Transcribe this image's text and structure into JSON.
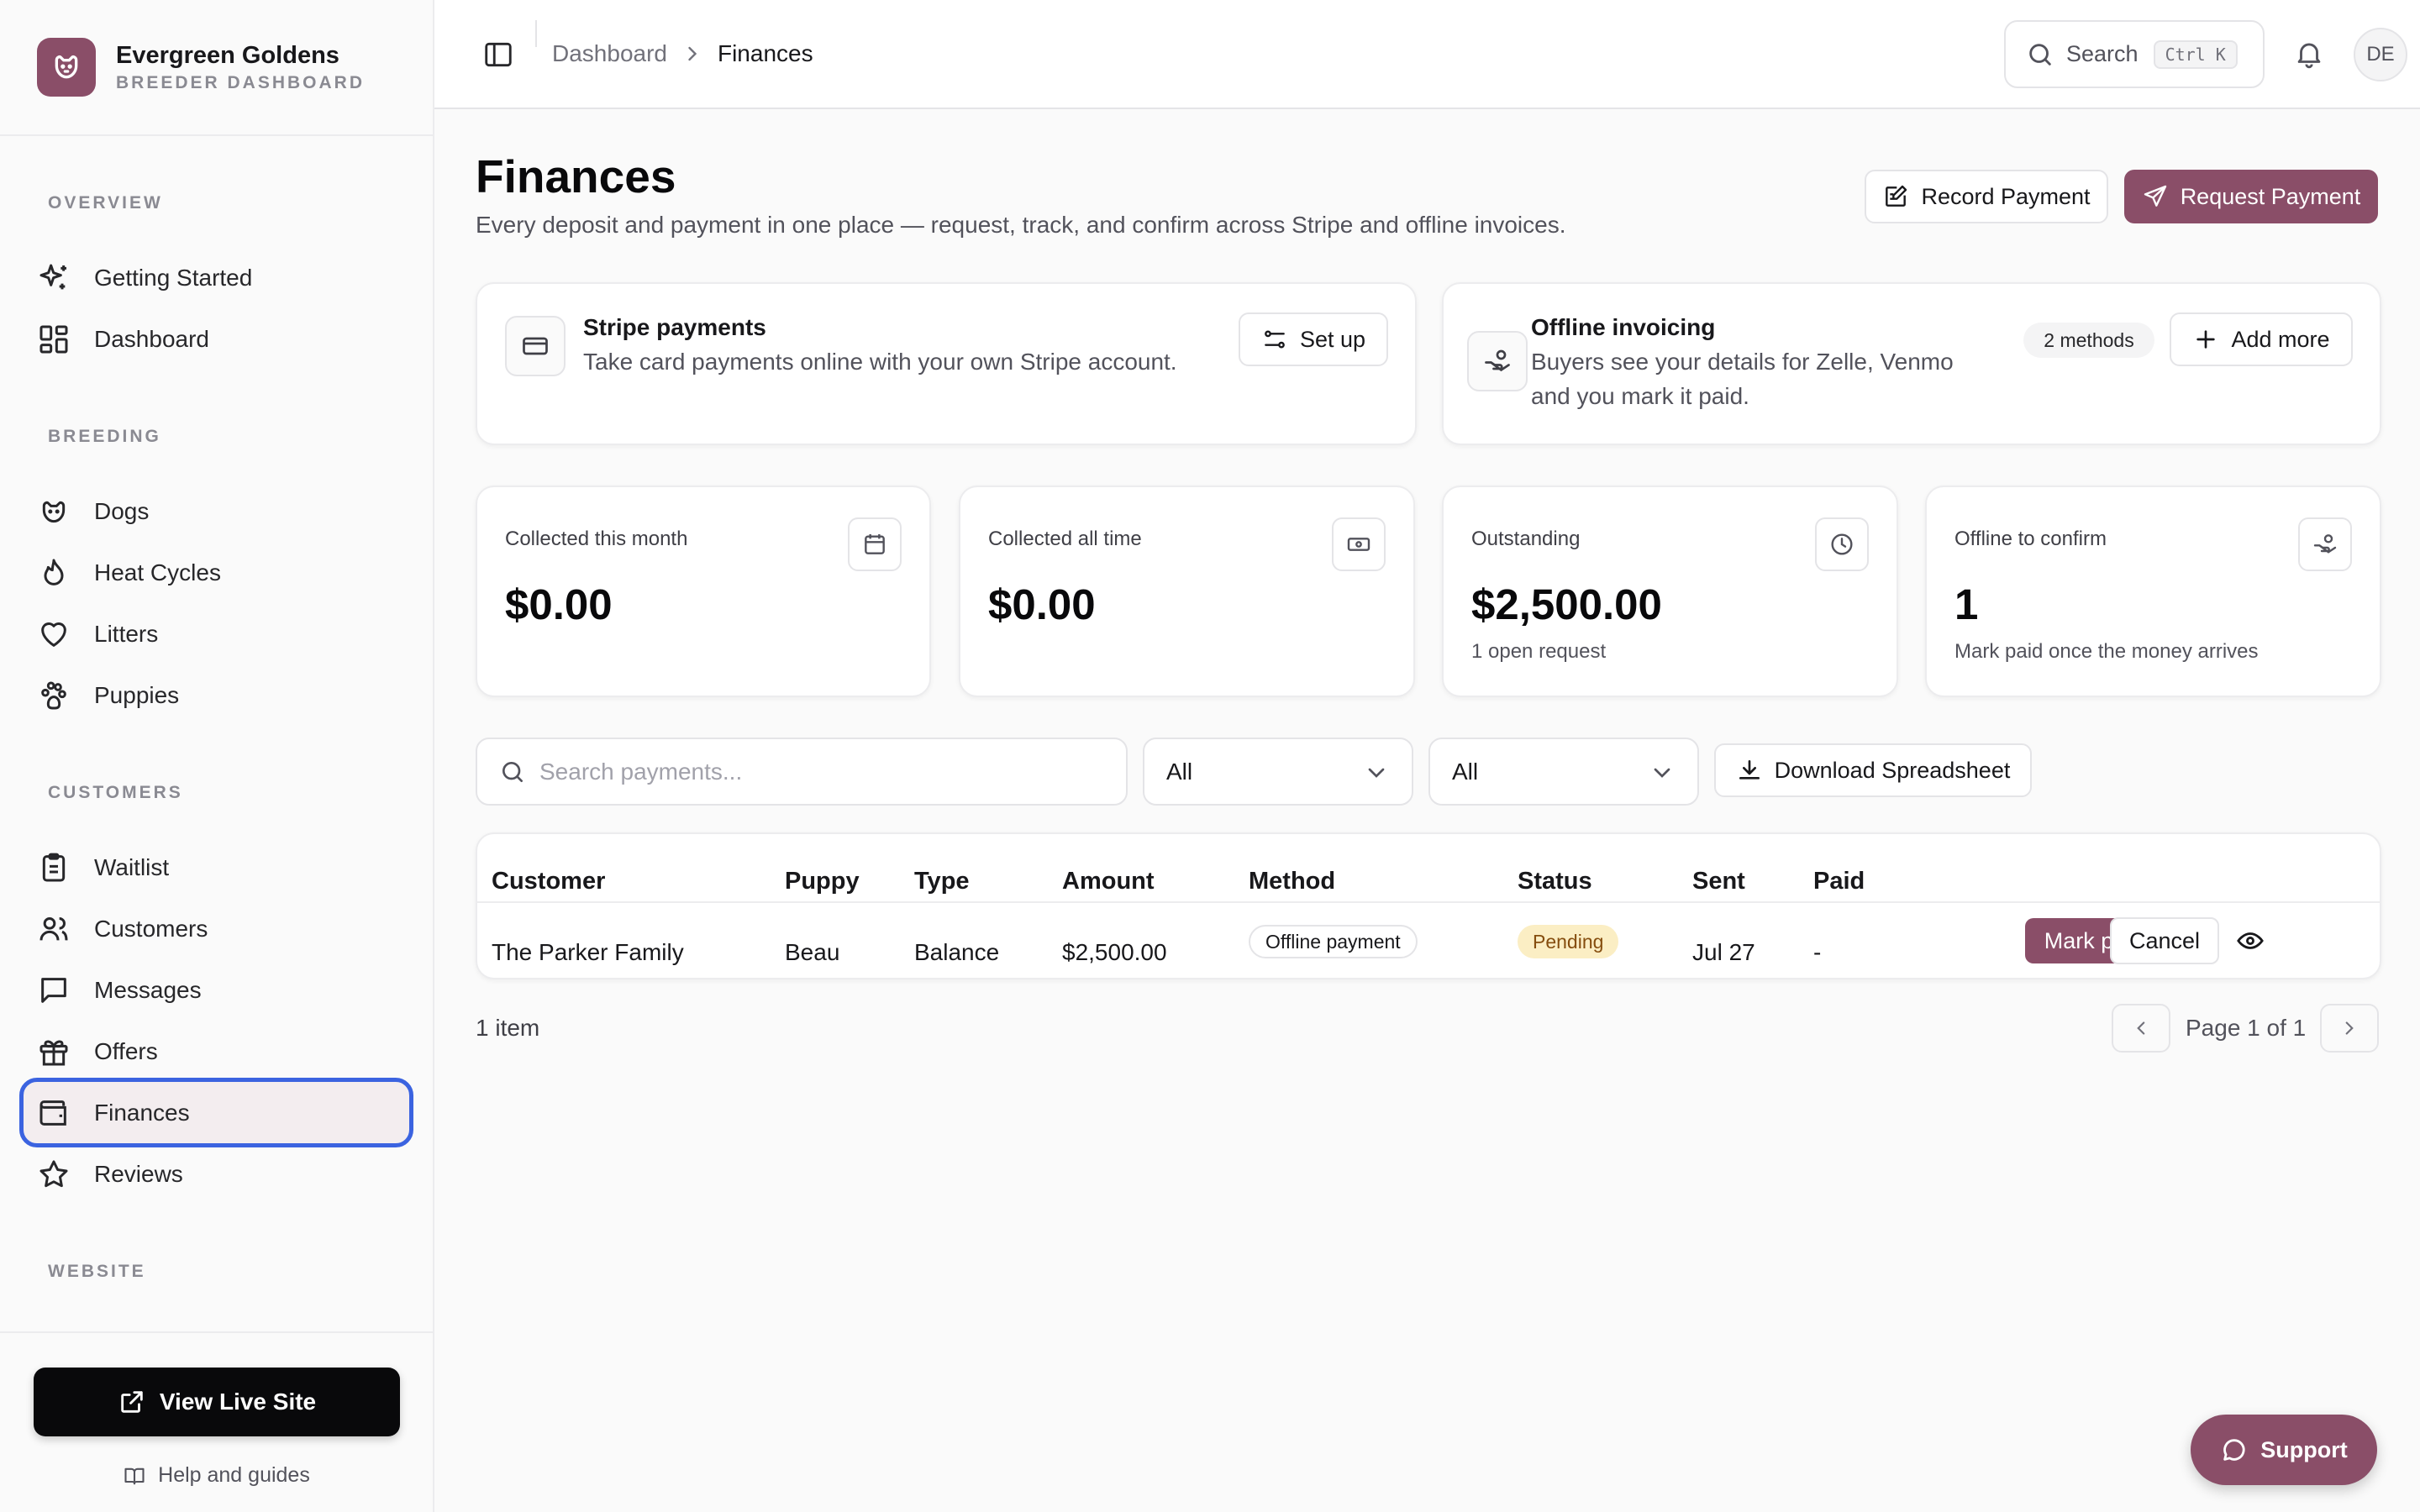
{
  "brand": {
    "name": "Evergreen Goldens",
    "subtitle": "BREEDER DASHBOARD"
  },
  "sidebar": {
    "sections": [
      {
        "heading": "OVERVIEW",
        "items": [
          {
            "label": "Getting Started",
            "icon": "sparkles-icon"
          },
          {
            "label": "Dashboard",
            "icon": "dashboard-grid-icon"
          }
        ]
      },
      {
        "heading": "BREEDING",
        "items": [
          {
            "label": "Dogs",
            "icon": "dog-icon"
          },
          {
            "label": "Heat Cycles",
            "icon": "flame-icon"
          },
          {
            "label": "Litters",
            "icon": "heart-icon"
          },
          {
            "label": "Puppies",
            "icon": "paw-icon"
          }
        ]
      },
      {
        "heading": "CUSTOMERS",
        "items": [
          {
            "label": "Waitlist",
            "icon": "clipboard-icon"
          },
          {
            "label": "Customers",
            "icon": "users-icon"
          },
          {
            "label": "Messages",
            "icon": "message-icon"
          },
          {
            "label": "Offers",
            "icon": "gift-icon"
          },
          {
            "label": "Finances",
            "icon": "wallet-icon",
            "active": true
          },
          {
            "label": "Reviews",
            "icon": "star-icon"
          }
        ]
      },
      {
        "heading": "WEBSITE",
        "items": []
      }
    ],
    "view_live_site": "View Live Site",
    "help": "Help and guides"
  },
  "topbar": {
    "breadcrumb": [
      "Dashboard",
      "Finances"
    ],
    "search_label": "Search",
    "search_shortcut": "Ctrl K",
    "avatar": "DE"
  },
  "page": {
    "title": "Finances",
    "subtitle": "Every deposit and payment in one place — request, track, and confirm across Stripe and offline invoices.",
    "record_payment": "Record Payment",
    "request_payment": "Request Payment"
  },
  "stripe_card": {
    "title": "Stripe payments",
    "desc": "Take card payments online with your own Stripe account.",
    "button": "Set up"
  },
  "offline_card": {
    "title": "Offline invoicing",
    "desc_line1": "Buyers see your details for Zelle, Venmo",
    "desc_line2": "and you mark it paid.",
    "badge": "2 methods",
    "button": "Add more"
  },
  "stats": [
    {
      "label": "Collected this month",
      "value": "$0.00",
      "note": "",
      "icon": "calendar-icon"
    },
    {
      "label": "Collected all time",
      "value": "$0.00",
      "note": "",
      "icon": "banknote-icon"
    },
    {
      "label": "Outstanding",
      "value": "$2,500.00",
      "note": "1 open request",
      "icon": "clock-icon"
    },
    {
      "label": "Offline to confirm",
      "value": "1",
      "note": "Mark paid once the money arrives",
      "icon": "hand-coins-icon"
    }
  ],
  "filters": {
    "search_placeholder": "Search payments...",
    "select1": "All",
    "select2": "All",
    "download": "Download Spreadsheet"
  },
  "table": {
    "headers": [
      "Customer",
      "Puppy",
      "Type",
      "Amount",
      "Method",
      "Status",
      "Sent",
      "Paid"
    ],
    "rows": [
      {
        "customer": "The Parker Family",
        "puppy": "Beau",
        "type": "Balance",
        "amount": "$2,500.00",
        "method": "Offline payment",
        "status": "Pending",
        "sent": "Jul 27",
        "paid": "-",
        "mark_paid": "Mark paid",
        "cancel": "Cancel"
      }
    ]
  },
  "pagination": {
    "count": "1 item",
    "page": "Page 1 of 1"
  },
  "support": "Support",
  "colors": {
    "brand": "#8a4e68",
    "focus": "#3b63e0",
    "pending_bg": "#fbeec4"
  }
}
